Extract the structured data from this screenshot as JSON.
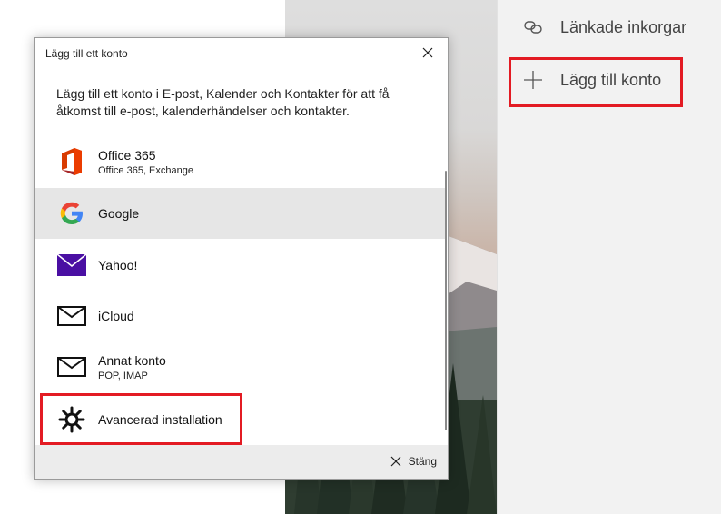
{
  "dialog": {
    "title": "Lägg till ett konto",
    "description": "Lägg till ett konto i E-post, Kalender och Kontakter för att få åtkomst till e-post, kalenderhändelser och kontakter.",
    "providers": [
      {
        "name": "Office 365",
        "sub": "Office 365, Exchange",
        "icon": "office-365-icon"
      },
      {
        "name": "Google",
        "sub": "",
        "icon": "google-icon"
      },
      {
        "name": "Yahoo!",
        "sub": "",
        "icon": "yahoo-mail-icon"
      },
      {
        "name": "iCloud",
        "sub": "",
        "icon": "envelope-icon"
      },
      {
        "name": "Annat konto",
        "sub": "POP, IMAP",
        "icon": "envelope-icon"
      },
      {
        "name": "Avancerad installation",
        "sub": "",
        "icon": "gear-icon"
      }
    ],
    "close_label": "Stäng"
  },
  "sidebar": {
    "linked_inboxes": "Länkade inkorgar",
    "add_account": "Lägg till konto"
  },
  "colors": {
    "highlight": "#e31b23",
    "selected_row": "#e6e6e6",
    "yahoo_purple": "#4a0fa3"
  }
}
